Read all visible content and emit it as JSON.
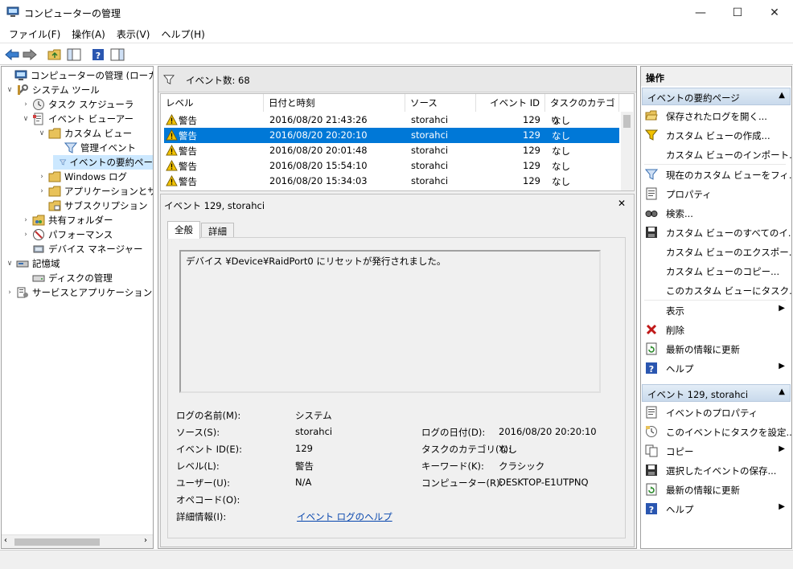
{
  "window": {
    "title": "コンピューターの管理",
    "minimize": "—",
    "maximize": "☐",
    "close": "✕"
  },
  "menu": [
    "ファイル(F)",
    "操作(A)",
    "表示(V)",
    "ヘルプ(H)"
  ],
  "tree": {
    "items": [
      {
        "label": "コンピューターの管理 (ローカル)",
        "icon": "computer-management-icon"
      },
      {
        "label": "システム ツール",
        "icon": "system-tools-icon"
      },
      {
        "label": "タスク スケジューラ",
        "icon": "clock-icon"
      },
      {
        "label": "イベント ビューアー",
        "icon": "event-viewer-icon"
      },
      {
        "label": "カスタム ビュー",
        "icon": "folder-icon"
      },
      {
        "label": "管理イベント",
        "icon": "filter-icon"
      },
      {
        "label": "イベントの要約ペー",
        "icon": "filter-icon"
      },
      {
        "label": "Windows ログ",
        "icon": "folder-icon"
      },
      {
        "label": "アプリケーションとサービ",
        "icon": "folder-icon"
      },
      {
        "label": "サブスクリプション",
        "icon": "subscription-icon"
      },
      {
        "label": "共有フォルダー",
        "icon": "shared-folder-icon"
      },
      {
        "label": "パフォーマンス",
        "icon": "performance-icon"
      },
      {
        "label": "デバイス マネージャー",
        "icon": "device-manager-icon"
      },
      {
        "label": "記憶域",
        "icon": "storage-icon"
      },
      {
        "label": "ディスクの管理",
        "icon": "disk-icon"
      },
      {
        "label": "サービスとアプリケーション",
        "icon": "services-icon"
      }
    ]
  },
  "events": {
    "header": "イベント数: 68",
    "columns": [
      "レベル",
      "日付と時刻",
      "ソース",
      "イベント ID",
      "タスクのカテゴリ"
    ],
    "rows": [
      {
        "level": "警告",
        "date": "2016/08/20 21:43:26",
        "source": "storahci",
        "id": "129",
        "category": "なし"
      },
      {
        "level": "警告",
        "date": "2016/08/20 20:20:10",
        "source": "storahci",
        "id": "129",
        "category": "なし"
      },
      {
        "level": "警告",
        "date": "2016/08/20 20:01:48",
        "source": "storahci",
        "id": "129",
        "category": "なし"
      },
      {
        "level": "警告",
        "date": "2016/08/20 15:54:10",
        "source": "storahci",
        "id": "129",
        "category": "なし"
      },
      {
        "level": "警告",
        "date": "2016/08/20 15:34:03",
        "source": "storahci",
        "id": "129",
        "category": "なし"
      }
    ]
  },
  "detail": {
    "title": "イベント 129, storahci",
    "close": "✕",
    "tabs": [
      "全般",
      "詳細"
    ],
    "message": "デバイス ¥Device¥RaidPort0 にリセットが発行されました。",
    "labels": {
      "log_name": "ログの名前(M):",
      "source": "ソース(S):",
      "event_id": "イベント ID(E):",
      "level": "レベル(L):",
      "user": "ユーザー(U):",
      "opcode": "オペコード(O):",
      "more_info": "詳細情報(I):",
      "logged": "ログの日付(D):",
      "task_category": "タスクのカテゴリ(Y):",
      "keywords": "キーワード(K):",
      "computer": "コンピューター(R):"
    },
    "values": {
      "log_name": "システム",
      "source": "storahci",
      "event_id": "129",
      "level": "警告",
      "user": "N/A",
      "more_info_link": "イベント ログのヘルプ",
      "logged": "2016/08/20 20:20:10",
      "task_category": "なし",
      "keywords": "クラシック",
      "computer": "DESKTOP-E1UTPNQ"
    }
  },
  "actions": {
    "title": "操作",
    "section1": "イベントの要約ページ",
    "items1": [
      {
        "label": "保存されたログを開く...",
        "icon": "open-folder-icon"
      },
      {
        "label": "カスタム ビューの作成...",
        "icon": "filter-create-icon"
      },
      {
        "label": "カスタム ビューのインポート...",
        "icon": ""
      },
      {
        "label": "現在のカスタム ビューをフィ...",
        "icon": "filter-icon"
      },
      {
        "label": "プロパティ",
        "icon": "properties-icon"
      },
      {
        "label": "検索...",
        "icon": "find-icon"
      },
      {
        "label": "カスタム ビューのすべてのイ...",
        "icon": "save-icon"
      },
      {
        "label": "カスタム ビューのエクスポー...",
        "icon": ""
      },
      {
        "label": "カスタム ビューのコピー...",
        "icon": ""
      },
      {
        "label": "このカスタム ビューにタスク...",
        "icon": ""
      },
      {
        "label": "表示",
        "icon": "",
        "submenu": "▶"
      },
      {
        "label": "削除",
        "icon": "delete-icon"
      },
      {
        "label": "最新の情報に更新",
        "icon": "refresh-icon"
      },
      {
        "label": "ヘルプ",
        "icon": "help-icon",
        "submenu": "▶"
      }
    ],
    "section2": "イベント 129, storahci",
    "items2": [
      {
        "label": "イベントのプロパティ",
        "icon": "properties-icon"
      },
      {
        "label": "このイベントにタスクを設定...",
        "icon": "task-icon"
      },
      {
        "label": "コピー",
        "icon": "copy-icon",
        "submenu": "▶"
      },
      {
        "label": "選択したイベントの保存...",
        "icon": "save-icon"
      },
      {
        "label": "最新の情報に更新",
        "icon": "refresh-icon"
      },
      {
        "label": "ヘルプ",
        "icon": "help-icon",
        "submenu": "▶"
      }
    ],
    "caret": "▲"
  }
}
